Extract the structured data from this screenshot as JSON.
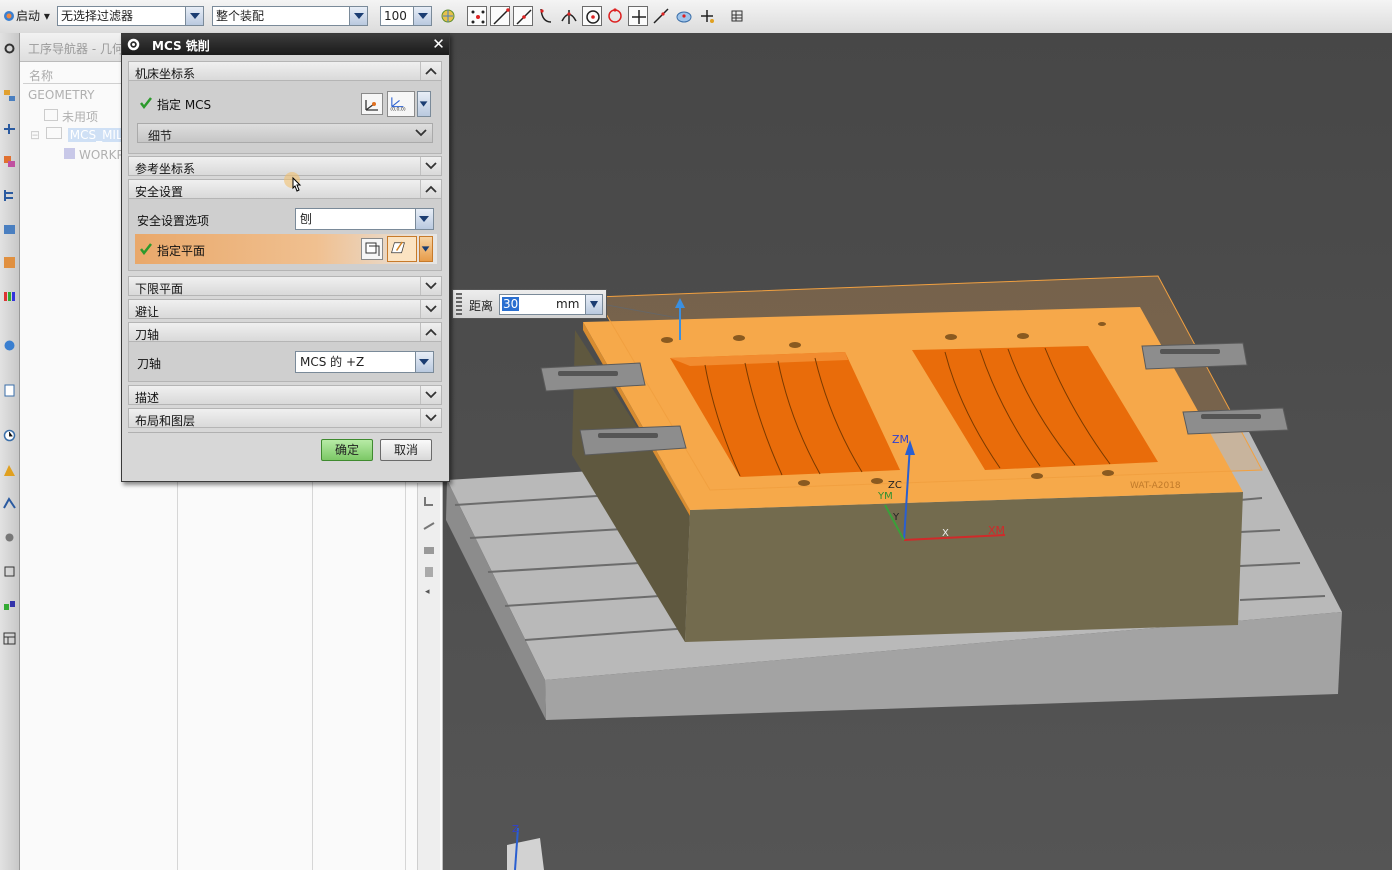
{
  "toolbar": {
    "start_label": "启动",
    "filter_value": "无选择过滤器",
    "assembly_value": "整个装配",
    "count_value": "100"
  },
  "navigator": {
    "title": "工序导航器 - 几何",
    "column_name": "名称",
    "rows": [
      "GEOMETRY",
      "未用项",
      "MCS_MILL",
      "WORKPIECE"
    ]
  },
  "dialog": {
    "title": "MCS 铣削",
    "sections": {
      "machine_csys": "机床坐标系",
      "reference_csys": "参考坐标系",
      "safety": "安全设置",
      "lower_plane": "下限平面",
      "avoidance": "避让",
      "tool_axis": "刀轴",
      "description": "描述",
      "layout_layers": "布局和图层"
    },
    "specify_mcs": "指定 MCS",
    "details": "细节",
    "safety_option_label": "安全设置选项",
    "safety_option_value": "刨",
    "specify_plane": "指定平面",
    "tool_axis_label": "刀轴",
    "tool_axis_value": "MCS 的 +Z",
    "ok": "确定",
    "cancel": "取消"
  },
  "distance": {
    "label": "距离",
    "value": "30",
    "unit": "mm"
  },
  "viewport": {
    "axis_labels": [
      "ZM",
      "ZC",
      "YM",
      "Y",
      "X",
      "XM"
    ],
    "triad_label": "Z"
  },
  "colors": {
    "part_orange": "#f6a94a",
    "pocket_orange": "#e96c0a",
    "mold_body": "#736b4e",
    "table_grey": "#a9a9a9",
    "highlight_row": "#e9a86a",
    "ok_green": "#8fd27a"
  }
}
